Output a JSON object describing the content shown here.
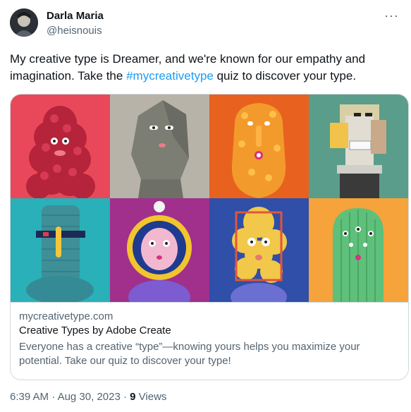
{
  "author": {
    "name": "Darla Maria",
    "handle": "@heisnouis",
    "more_label": "···"
  },
  "tweet": {
    "text_before": "My creative type is Dreamer, and we're known for our empathy and imagination. Take the ",
    "hashtag": "#mycreativetype",
    "text_after": " quiz to discover your type."
  },
  "card": {
    "domain": "mycreativetype.com",
    "title": "Creative Types by Adobe Create",
    "description": "Everyone has a creative “type”—knowing yours helps you maximize your potential. Take our quiz to discover your type!",
    "tiles": [
      {
        "label": "pink-fluffy-character",
        "bg": "#e8485a"
      },
      {
        "label": "stone-face-character",
        "bg": "#a8a49a"
      },
      {
        "label": "orange-fuzzy-character",
        "bg": "#e8611f"
      },
      {
        "label": "blocky-cubist-character",
        "bg": "#5a9d8a"
      },
      {
        "label": "teal-totem-character",
        "bg": "#2ab0b8"
      },
      {
        "label": "astronaut-character",
        "bg": "#a0308c"
      },
      {
        "label": "yellow-bubbles-character",
        "bg": "#2f4fa8"
      },
      {
        "label": "green-cactus-character",
        "bg": "#f5a33a"
      }
    ]
  },
  "meta": {
    "time": "6:39 AM",
    "sep": "·",
    "date": "Aug 30, 2023",
    "views_count": "9",
    "views_label": "Views"
  },
  "colors": {
    "accent": "#1d9bf0",
    "secondary_text": "#536471",
    "border": "#cfd9de"
  }
}
